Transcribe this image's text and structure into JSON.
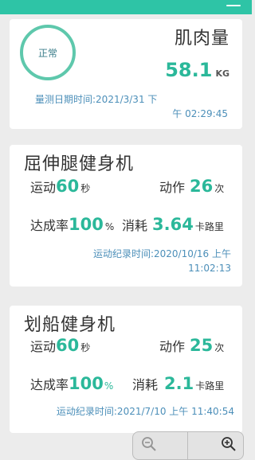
{
  "body_card": {
    "status": "正常",
    "title": "肌肉量",
    "value": "58.1",
    "unit": "KG",
    "time_line1": "量测日期时间:2021/3/31 下",
    "time_line2": "午 02:29:45"
  },
  "sessions": [
    {
      "name": "屈伸腿健身机",
      "duration_label": "运动",
      "duration_value": "60",
      "duration_unit": "秒",
      "reps_label": "动作",
      "reps_value": "26",
      "reps_unit": "次",
      "rate_label": "达成率",
      "rate_value": "100",
      "rate_unit": "%",
      "cal_label": "消耗",
      "cal_value": "3.64",
      "cal_unit": "卡路里",
      "record_line1": "运动纪录时间:2020/10/16 上午",
      "record_line2": "11:02:13"
    },
    {
      "name": "划船健身机",
      "duration_label": "运动",
      "duration_value": "60",
      "duration_unit": "秒",
      "reps_label": "动作",
      "reps_value": "25",
      "reps_unit": "次",
      "rate_label": "达成率",
      "rate_value": "100",
      "rate_unit": "%",
      "cal_label": "消耗",
      "cal_value": "2.1",
      "cal_unit": "卡路里",
      "record_line1": "运动纪录时间:2021/7/10 上午 11:40:54"
    }
  ],
  "icons": {
    "menu": "menu-icon",
    "zoom_out": "zoom-out-icon",
    "zoom_in": "zoom-in-icon"
  },
  "colors": {
    "accent_green": "#2bb89a",
    "ring_green": "#5ec8ac",
    "time_blue": "#4c8fb9",
    "background": "#ececec"
  }
}
